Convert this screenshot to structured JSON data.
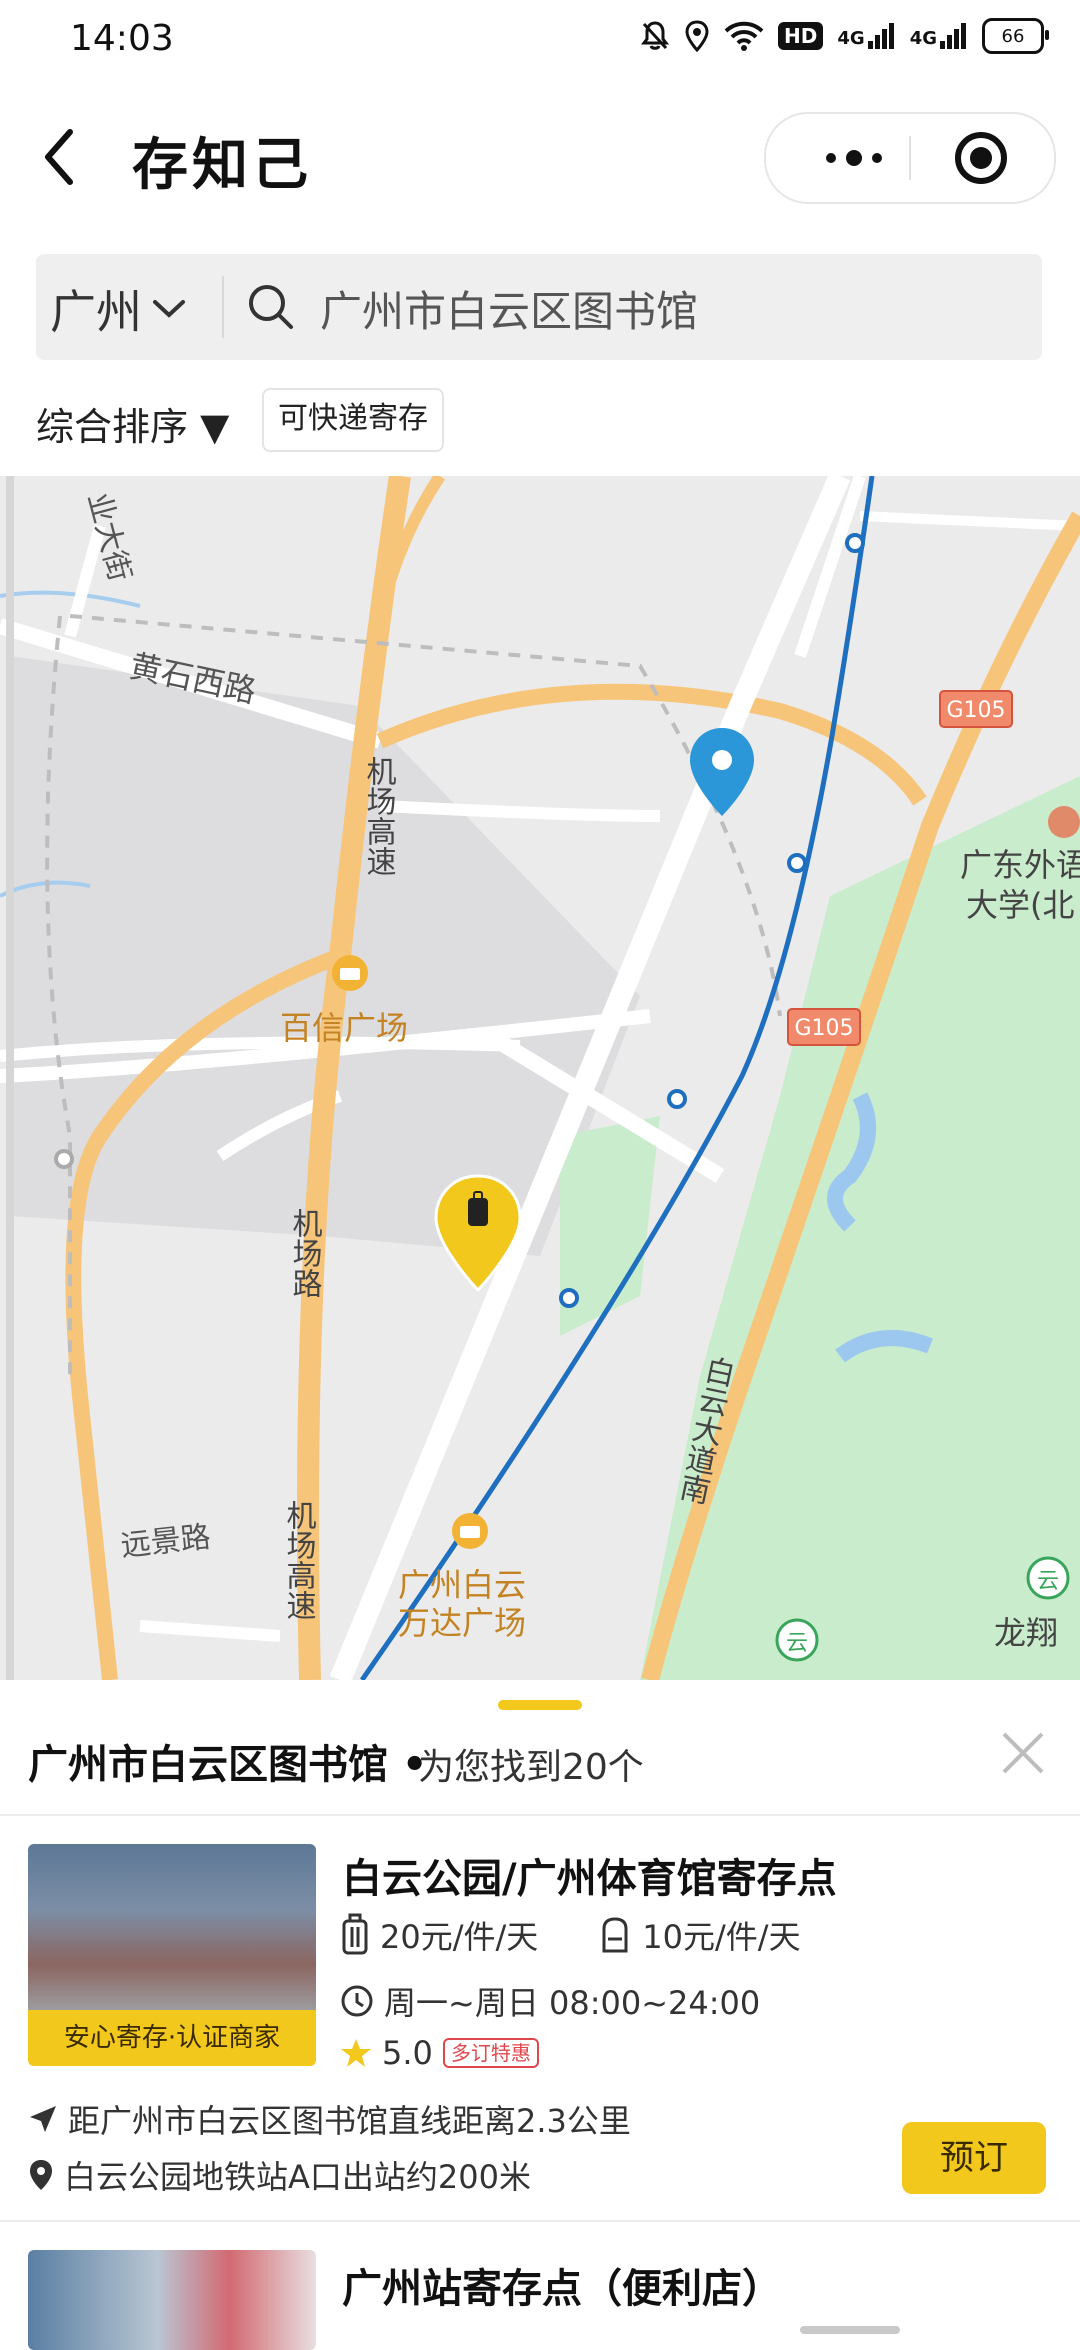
{
  "status_bar": {
    "time": "14:03",
    "net1": "4G",
    "net2": "4G",
    "hd": "HD",
    "battery": "66"
  },
  "header": {
    "title": "存知己",
    "icons": [
      "back-icon",
      "more-dots-icon",
      "target-icon"
    ]
  },
  "search": {
    "city": "广州",
    "query": "广州市白云区图书馆"
  },
  "filters": {
    "sort_label": "综合排序 ▼",
    "chip_label": "可快递寄存"
  },
  "map": {
    "labels": {
      "ye_da_jie": "业大街",
      "huang_shi_xi_lu": "黄石西路",
      "jichang_gaosu_1": "机场高速",
      "jichang_lu": "机场路",
      "jichang_gaosu_2": "机场高速",
      "baixin": "百信广场",
      "wanda_line1": "广州白云",
      "wanda_line2": "万达广场",
      "yuanjing": "远景路",
      "baiyun_dadao": "白云大道南",
      "guangwai_1": "广东外语",
      "guangwai_2": "大学(北",
      "longxiang": "龙翔",
      "g105_a": "G105",
      "g105_b": "G105"
    },
    "colors": {
      "road_major": "#f6c57a",
      "metro": "#1f6fc0",
      "park": "#c9eccc",
      "pin": "#2b96d8"
    }
  },
  "results": {
    "location": "广州市白云区图书馆",
    "count_text": "为您找到20个",
    "items": [
      {
        "name": "白云公园/广州体育馆寄存点",
        "badge": "安心寄存·认证商家",
        "price_luggage": "20元/件/天",
        "price_bag": "10元/件/天",
        "hours": "周一~周日 08:00~24:00",
        "rating": "5.0",
        "promo": "多订特惠",
        "distance": "距广州市白云区图书馆直线距离2.3公里",
        "address": "白云公园地铁站A口出站约200米",
        "book_label": "预订"
      },
      {
        "name": "广州站寄存点（便利店）"
      }
    ]
  }
}
